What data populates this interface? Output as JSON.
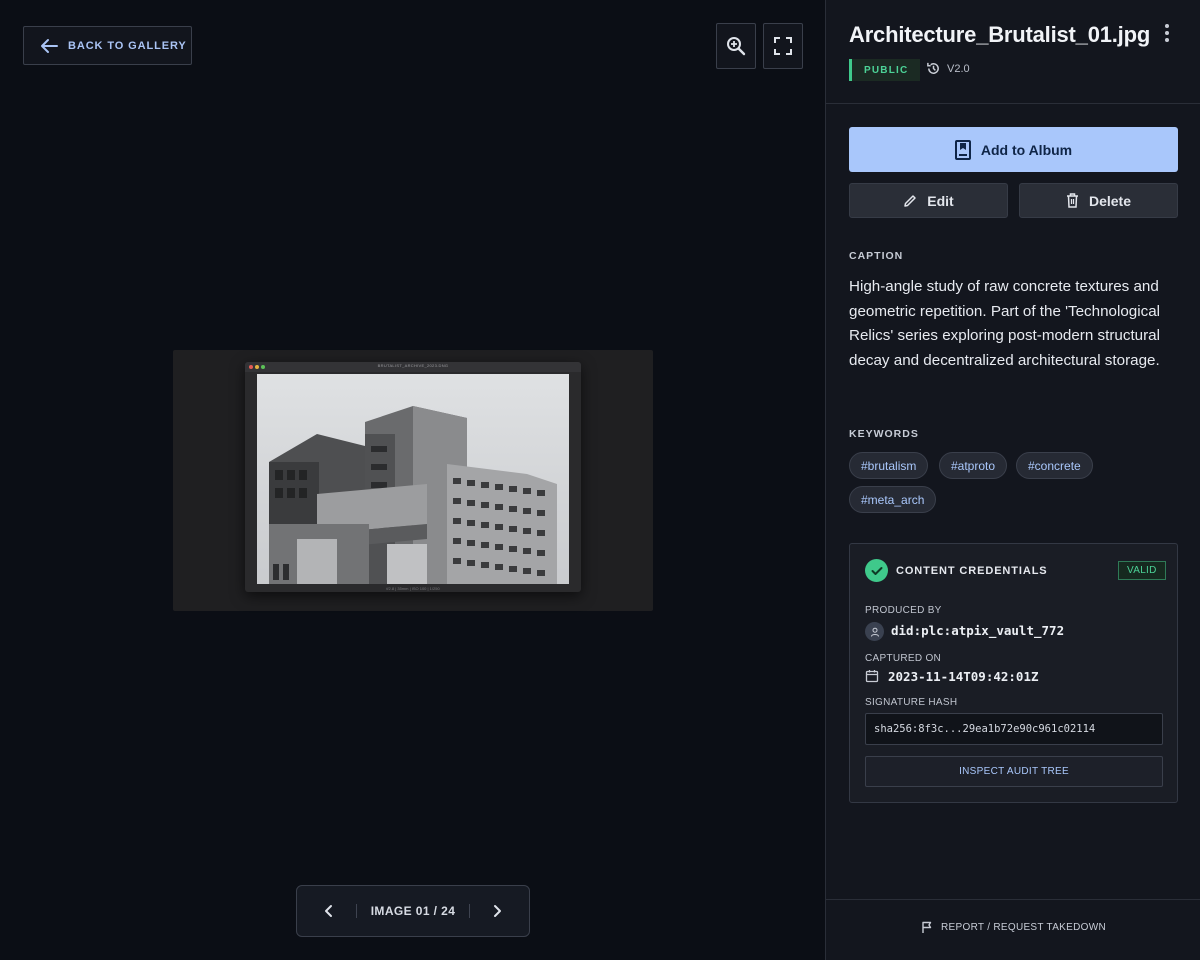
{
  "viewer": {
    "back_label": "BACK TO GALLERY",
    "zoom_icon": "zoom-in-icon",
    "fullscreen_icon": "fullscreen-icon",
    "preview": {
      "window_title": "BRUTALIST_ARCHIVE_2023.DNG",
      "footer_text": "f/2.8 | 35mm | ISO 100 | 1/250"
    },
    "pager": {
      "count_label": "IMAGE 01 / 24"
    }
  },
  "panel": {
    "file_name": "Architecture_Brutalist_01.jpg",
    "visibility": "PUBLIC",
    "version": "V2.0",
    "add_album_label": "Add to Album",
    "edit_label": "Edit",
    "delete_label": "Delete",
    "caption_heading": "CAPTION",
    "caption_text": "High-angle study of raw concrete textures and geometric repetition. Part of the 'Technological Relics' series exploring post-modern structural decay and decentralized architectural storage.",
    "keywords_heading": "KEYWORDS",
    "keywords": [
      "#brutalism",
      "#atproto",
      "#concrete",
      "#meta_arch"
    ],
    "credentials": {
      "title": "CONTENT CREDENTIALS",
      "status": "VALID",
      "produced_by_label": "PRODUCED BY",
      "produced_by": "did:plc:atpix_vault_772",
      "captured_on_label": "CAPTURED ON",
      "captured_on": "2023-11-14T09:42:01Z",
      "signature_label": "SIGNATURE HASH",
      "signature_hash": "sha256:8f3c...29ea1b72e90c961c02114",
      "audit_label": "INSPECT AUDIT TREE"
    },
    "report_label": "REPORT / REQUEST TAKEDOWN"
  },
  "colors": {
    "accent": "#a9c7fb",
    "success": "#3fc98b",
    "background": "#0b0e15",
    "panel": "#13161e"
  }
}
